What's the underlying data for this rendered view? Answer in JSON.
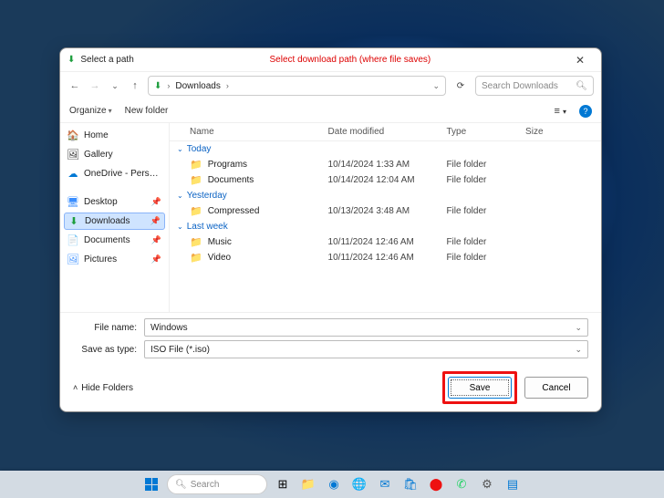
{
  "titlebar": {
    "title": "Select a path",
    "annotation": "Select download path (where file saves)"
  },
  "nav": {
    "location": "Downloads",
    "search_placeholder": "Search Downloads"
  },
  "toolbar": {
    "organize": "Organize",
    "newfolder": "New folder"
  },
  "sidebar": {
    "home": "Home",
    "gallery": "Gallery",
    "onedrive": "OneDrive - Pers…",
    "desktop": "Desktop",
    "downloads": "Downloads",
    "documents": "Documents",
    "pictures": "Pictures"
  },
  "columns": {
    "name": "Name",
    "date": "Date modified",
    "type": "Type",
    "size": "Size"
  },
  "groups": [
    {
      "label": "Today",
      "items": [
        {
          "name": "Programs",
          "date": "10/14/2024 1:33 AM",
          "type": "File folder"
        },
        {
          "name": "Documents",
          "date": "10/14/2024 12:04 AM",
          "type": "File folder"
        }
      ]
    },
    {
      "label": "Yesterday",
      "items": [
        {
          "name": "Compressed",
          "date": "10/13/2024 3:48 AM",
          "type": "File folder"
        }
      ]
    },
    {
      "label": "Last week",
      "items": [
        {
          "name": "Music",
          "date": "10/11/2024 12:46 AM",
          "type": "File folder"
        },
        {
          "name": "Video",
          "date": "10/11/2024 12:46 AM",
          "type": "File folder"
        }
      ]
    }
  ],
  "fields": {
    "filename_label": "File name:",
    "filename_value": "Windows",
    "savetype_label": "Save as type:",
    "savetype_value": "ISO File (*.iso)"
  },
  "footer": {
    "hide": "Hide Folders",
    "save": "Save",
    "cancel": "Cancel"
  },
  "taskbar": {
    "search": "Search"
  }
}
